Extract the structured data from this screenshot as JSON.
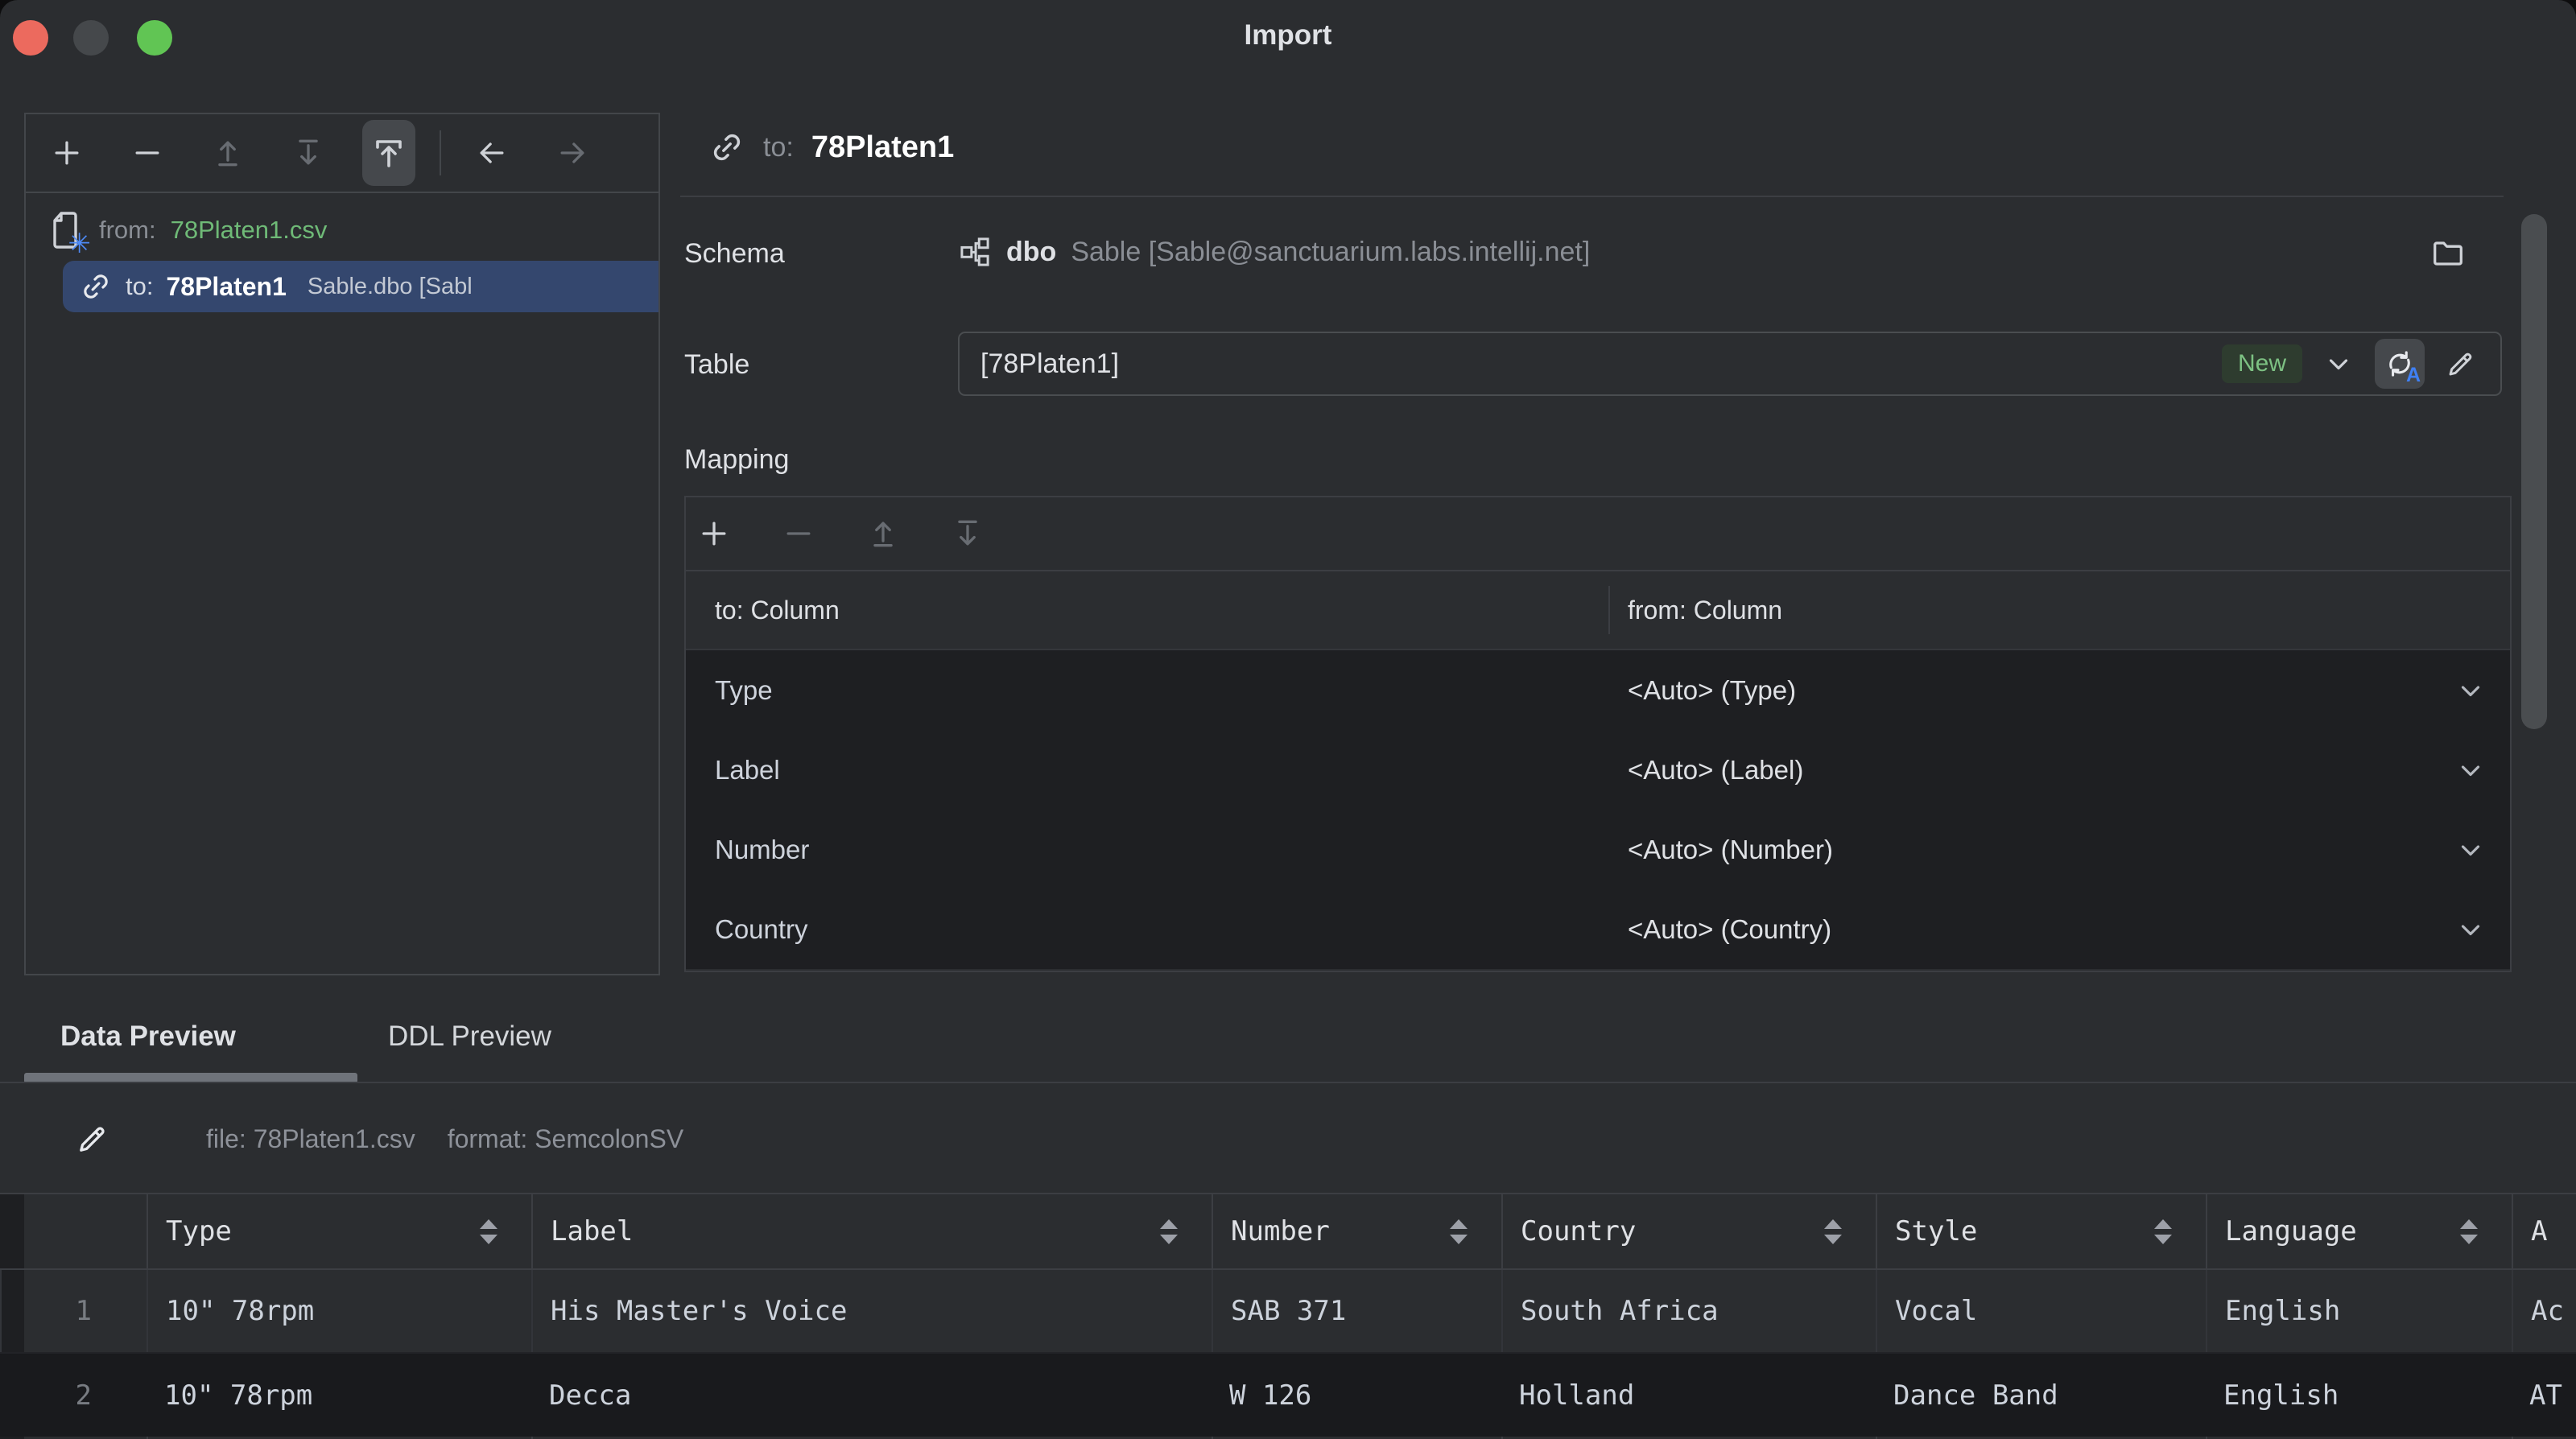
{
  "window": {
    "title": "Import"
  },
  "colors": {
    "background": "#2b2d30",
    "panel_dark": "#1e1f22",
    "border": "#43464a",
    "selection_blue": "#34476e",
    "file_green": "#6fba77",
    "badge_green": "#7dc183",
    "accent_blue": "#4e8af7",
    "text_primary": "#dfe1e5",
    "text_muted": "#8a8e95",
    "traffic_red": "#ec6a5e",
    "traffic_gray": "#45484b",
    "traffic_green": "#61c554"
  },
  "icons": {
    "left_toolbar": [
      "add-icon",
      "remove-icon",
      "move-up-icon",
      "move-down-icon",
      "upload-icon",
      "back-icon",
      "forward-icon"
    ],
    "mapping_toolbar": [
      "add-icon",
      "remove-icon",
      "move-up-icon",
      "move-down-icon"
    ],
    "other": [
      "link-icon",
      "csv-file-icon",
      "schema-icon",
      "folder-icon",
      "chevron-down-icon",
      "sync-rename-icon",
      "pencil-icon",
      "sort-icon"
    ]
  },
  "left_panel": {
    "tree": {
      "from_item": {
        "prefix": "from:",
        "name": "78Platen1.csv"
      },
      "to_item": {
        "prefix": "to:",
        "name": "78Platen1",
        "detail": "Sable.dbo [Sabl"
      }
    }
  },
  "target_header": {
    "prefix": "to:",
    "name": "78Platen1"
  },
  "schema_row": {
    "label": "Schema",
    "schema_name": "dbo",
    "schema_detail": "Sable [Sable@sanctuarium.labs.intellij.net]"
  },
  "table_row": {
    "label": "Table",
    "value": "[78Platen1]",
    "badge": "New"
  },
  "mapping": {
    "label": "Mapping",
    "header": {
      "to": "to: Column",
      "from": "from: Column"
    },
    "rows": [
      {
        "to": "Type",
        "from": "<Auto> (Type)"
      },
      {
        "to": "Label",
        "from": "<Auto> (Label)"
      },
      {
        "to": "Number",
        "from": "<Auto> (Number)"
      },
      {
        "to": "Country",
        "from": "<Auto> (Country)"
      }
    ]
  },
  "tabs": [
    {
      "label": "Data Preview",
      "active": true
    },
    {
      "label": "DDL Preview",
      "active": false
    }
  ],
  "file_info": {
    "file": "file: 78Platen1.csv",
    "format": "format: SemcolonSV"
  },
  "preview_table": {
    "columns": [
      "Type",
      "Label",
      "Number",
      "Country",
      "Style",
      "Language",
      "A"
    ],
    "rows": [
      {
        "num": "1",
        "cells": [
          "10\" 78rpm",
          "His Master's Voice",
          "SAB 371",
          "South Africa",
          "Vocal",
          "English",
          "Ac"
        ]
      },
      {
        "num": "2",
        "cells": [
          "10\" 78rpm",
          "Decca",
          "W 126",
          "Holland",
          "Dance Band",
          "English",
          "AT"
        ]
      }
    ]
  }
}
